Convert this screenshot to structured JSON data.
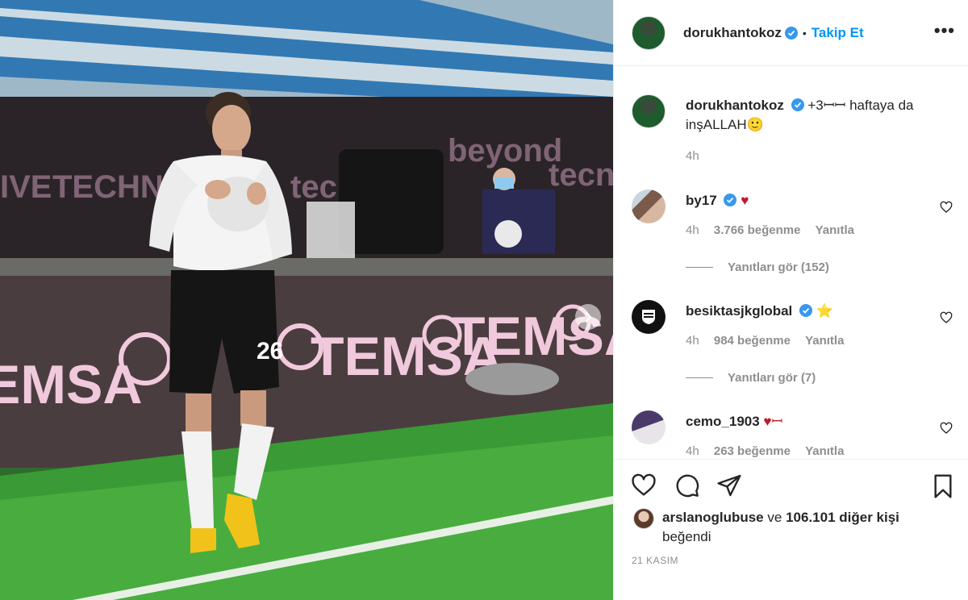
{
  "post": {
    "username": "dorukhantokoz",
    "separator": "•",
    "follow_label": "Takip Et",
    "more_label": "•••",
    "caption": "+3ꟷꟷ haftaya da inşALLAH🙂",
    "caption_time": "4h"
  },
  "comments": [
    {
      "username": "by17",
      "text": "♥",
      "time": "4h",
      "likes": "3.766 beğenme",
      "reply": "Yanıtla",
      "view_replies": "Yanıtları gör (152)"
    },
    {
      "username": "besiktasjkglobal",
      "text": "⭐",
      "time": "4h",
      "likes": "984 beğenme",
      "reply": "Yanıtla",
      "view_replies": "Yanıtları gör (7)"
    },
    {
      "username": "cemo_1903",
      "text": "♥ꟷ",
      "time": "4h",
      "likes": "263 beğenme",
      "reply": "Yanıtla"
    }
  ],
  "likes": {
    "first_user": "arslanoglubuse",
    "connector": "ve",
    "others": "106.101 diğer kişi",
    "suffix": "beğendi"
  },
  "date": "21 KASIM",
  "icons": {
    "verified": "verified-badge-icon",
    "heart": "heart-icon",
    "comment": "comment-icon",
    "share": "share-icon",
    "save": "bookmark-icon",
    "next": "chevron-right-icon"
  },
  "colors": {
    "accent": "#0095f6",
    "verified": "#3897f0",
    "text": "#262626",
    "muted": "#8e8e8e"
  }
}
